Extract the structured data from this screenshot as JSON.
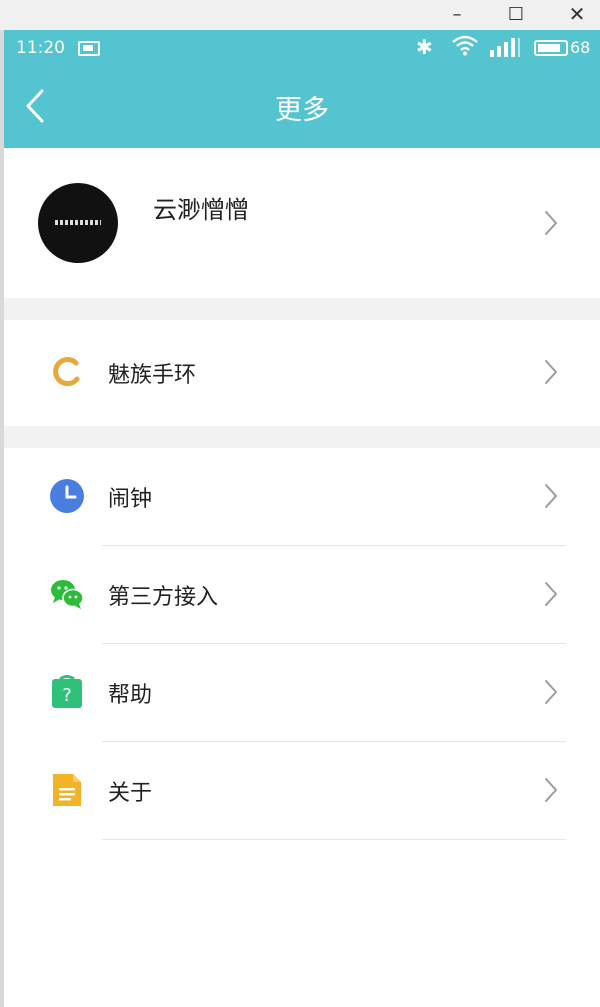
{
  "window": {
    "minimize_symbol": "–",
    "maximize_symbol": "☐",
    "close_symbol": "✕"
  },
  "status_bar": {
    "time": "11:20",
    "battery": "68"
  },
  "header": {
    "title": "更多",
    "background": "#54c4d0"
  },
  "profile": {
    "name": "云渺憎憎"
  },
  "device_section": {
    "items": [
      {
        "label": "魅族手环",
        "icon": "band-ring-icon",
        "color": "#e7a83b"
      }
    ]
  },
  "menu_section": {
    "items": [
      {
        "label": "闹钟",
        "icon": "clock-icon",
        "color": "#4a7de0"
      },
      {
        "label": "第三方接入",
        "icon": "wechat-icon",
        "color": "#2dbb3a"
      },
      {
        "label": "帮助",
        "icon": "help-icon",
        "color": "#2fc07a"
      },
      {
        "label": "关于",
        "icon": "document-icon",
        "color": "#f2b327"
      }
    ]
  }
}
